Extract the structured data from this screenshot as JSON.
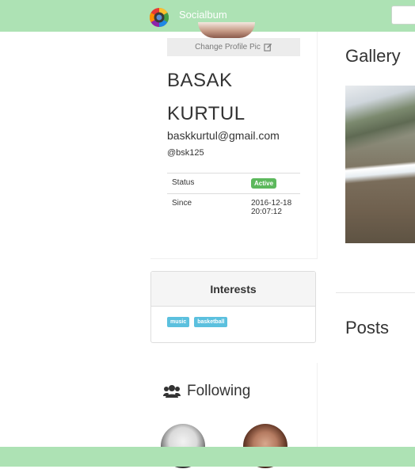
{
  "navbar": {
    "brand": "Socialbum",
    "logo_icon": "camera-lens-logo-icon",
    "accent_color": "#ade2b4"
  },
  "profile": {
    "change_pic_label": "Change Profile Pic",
    "first_name": "BASAK",
    "last_name": "KURTUL",
    "email": "baskkurtul@gmail.com",
    "handle": "@bsk125",
    "info": {
      "status_label": "Status",
      "status_value": "Active",
      "since_label": "Since",
      "since_date": "2016-12-18",
      "since_time": "20:07:12"
    }
  },
  "interests": {
    "title": "Interests",
    "tags": [
      "music",
      "basketball"
    ]
  },
  "following": {
    "title": "Following",
    "icon": "users-icon"
  },
  "main": {
    "gallery_title": "Gallery",
    "posts_title": "Posts"
  }
}
